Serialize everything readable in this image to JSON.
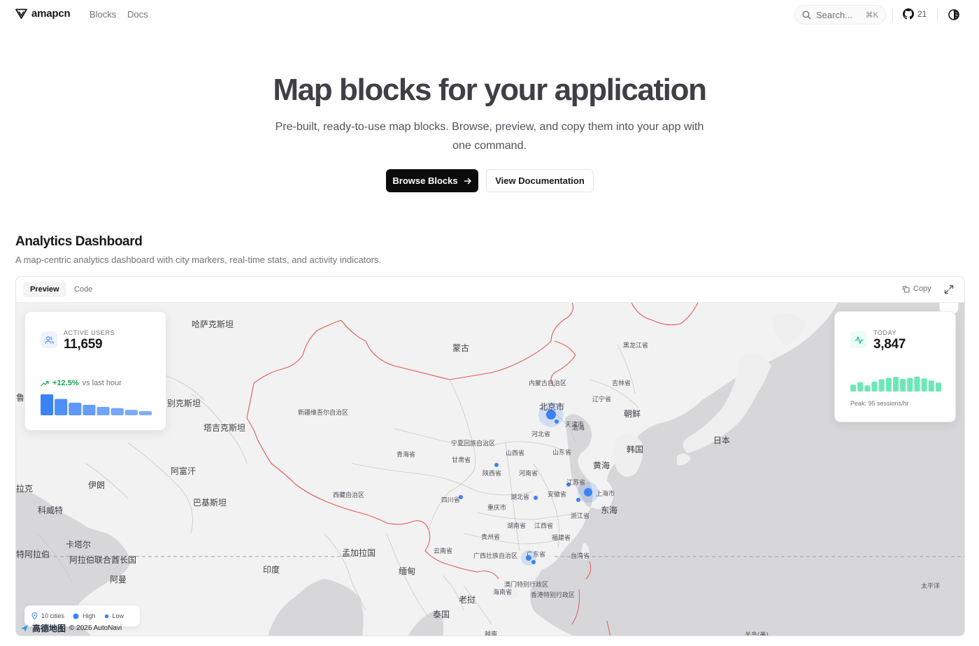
{
  "header": {
    "brand": "amapcn",
    "nav": [
      {
        "label": "Blocks"
      },
      {
        "label": "Docs"
      }
    ],
    "search": {
      "placeholder": "Search...",
      "shortcut": "⌘K"
    },
    "github_stars": "21"
  },
  "hero": {
    "title": "Map blocks for your application",
    "subtitle": "Pre-built, ready-to-use map blocks. Browse, preview, and copy them into your app with one command.",
    "primary_button": "Browse Blocks",
    "secondary_button": "View Documentation"
  },
  "section": {
    "title": "Analytics Dashboard",
    "description": "A map-centric analytics dashboard with city markers, real-time stats, and activity indicators.",
    "tabs": [
      {
        "label": "Preview",
        "active": true
      },
      {
        "label": "Code",
        "active": false
      }
    ],
    "copy_label": "Copy"
  },
  "dashboard": {
    "active_users": {
      "label": "ACTIVE USERS",
      "value": "11,659",
      "delta": "+12.5%",
      "delta_text": "vs last hour",
      "bars": [
        1.0,
        0.78,
        0.6,
        0.5,
        0.4,
        0.34,
        0.26,
        0.2
      ]
    },
    "today": {
      "label": "TODAY",
      "value": "3,847",
      "peak_text": "Peak: 95 sessions/hr",
      "bars": [
        0.45,
        0.6,
        0.4,
        0.65,
        0.8,
        0.9,
        0.95,
        0.82,
        0.88,
        0.97,
        0.85,
        0.72,
        0.58
      ]
    },
    "legend": {
      "cities": "10 cities",
      "high": "High",
      "low": "Low"
    },
    "attribution": {
      "logo_text": "高德地图",
      "copyright": "© 2026 AutoNavi"
    },
    "colors": {
      "accent": "#3b82f6",
      "positive": "#16a34a",
      "today_bars": "#6ee7b7",
      "users_bars": "#3b82f6",
      "border_line": "#e05a5a"
    }
  },
  "map_labels": [
    {
      "text": "哈萨克斯坦",
      "size": "l"
    },
    {
      "text": "蒙古",
      "size": "l"
    },
    {
      "text": "黑龙江省",
      "size": "s"
    },
    {
      "text": "内蒙古自治区",
      "size": "s"
    },
    {
      "text": "吉林省",
      "size": "s"
    },
    {
      "text": "辽宁省",
      "size": "s"
    },
    {
      "text": "北京市",
      "size": "l"
    },
    {
      "text": "天津市",
      "size": "s"
    },
    {
      "text": "渤海",
      "size": "s"
    },
    {
      "text": "朝鲜",
      "size": "l"
    },
    {
      "text": "新疆维吾尔自治区",
      "size": "s"
    },
    {
      "text": "别克斯坦",
      "size": "l"
    },
    {
      "text": "塔吉克斯坦",
      "size": "l"
    },
    {
      "text": "河北省",
      "size": "s"
    },
    {
      "text": "日本",
      "size": "l"
    },
    {
      "text": "宁夏回族自治区",
      "size": "s"
    },
    {
      "text": "韩国",
      "size": "l"
    },
    {
      "text": "青海省",
      "size": "s"
    },
    {
      "text": "山西省",
      "size": "s"
    },
    {
      "text": "山东省",
      "size": "s"
    },
    {
      "text": "甘肃省",
      "size": "s"
    },
    {
      "text": "黄海",
      "size": "l"
    },
    {
      "text": "阿富汗",
      "size": "l"
    },
    {
      "text": "陕西省",
      "size": "s"
    },
    {
      "text": "河南省",
      "size": "s"
    },
    {
      "text": "伊朗",
      "size": "l"
    },
    {
      "text": "江苏省",
      "size": "s"
    },
    {
      "text": "拉克",
      "size": "l"
    },
    {
      "text": "西藏自治区",
      "size": "s"
    },
    {
      "text": "上海市",
      "size": "s"
    },
    {
      "text": "安徽省",
      "size": "s"
    },
    {
      "text": "湖北省",
      "size": "s"
    },
    {
      "text": "四川省",
      "size": "s"
    },
    {
      "text": "巴基斯坦",
      "size": "l"
    },
    {
      "text": "重庆市",
      "size": "s"
    },
    {
      "text": "东海",
      "size": "l"
    },
    {
      "text": "科威特",
      "size": "l"
    },
    {
      "text": "浙江省",
      "size": "s"
    },
    {
      "text": "湖南省",
      "size": "s"
    },
    {
      "text": "江西省",
      "size": "s"
    },
    {
      "text": "贵州省",
      "size": "s"
    },
    {
      "text": "福建省",
      "size": "s"
    },
    {
      "text": "卡塔尔",
      "size": "l"
    },
    {
      "text": "特阿拉伯",
      "size": "l"
    },
    {
      "text": "孟加拉国",
      "size": "l"
    },
    {
      "text": "云南省",
      "size": "s"
    },
    {
      "text": "广西壮族自治区",
      "size": "s"
    },
    {
      "text": "广东省",
      "size": "s"
    },
    {
      "text": "台湾省",
      "size": "s"
    },
    {
      "text": "阿拉伯联合酋长国",
      "size": "l"
    },
    {
      "text": "印度",
      "size": "l"
    },
    {
      "text": "缅甸",
      "size": "l"
    },
    {
      "text": "阿曼",
      "size": "l"
    },
    {
      "text": "澳门特别行政区",
      "size": "s"
    },
    {
      "text": "太平洋",
      "size": "s"
    },
    {
      "text": "海南省",
      "size": "s"
    },
    {
      "text": "香港特别行政区",
      "size": "s"
    },
    {
      "text": "老挝",
      "size": "l"
    },
    {
      "text": "泰国",
      "size": "l"
    },
    {
      "text": "越南",
      "size": "s"
    },
    {
      "text": "关岛(美)",
      "size": "s"
    },
    {
      "text": "鲁",
      "size": "l"
    }
  ]
}
